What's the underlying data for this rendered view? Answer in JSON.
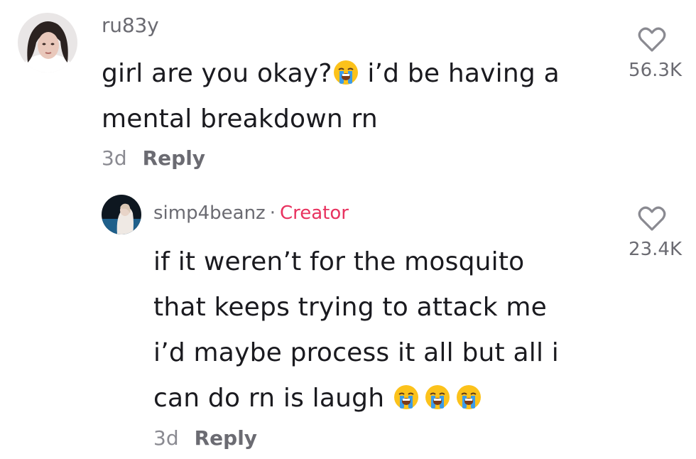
{
  "comment": {
    "username": "ru83y",
    "text_line1_a": "girl are you okay?",
    "text_line1_b": " i’d be having a",
    "text_line2": "mental breakdown rn",
    "emoji": "loudly-crying-face",
    "time": "3d",
    "reply_label": "Reply",
    "like_count": "56.3K"
  },
  "reply": {
    "username": "simp4beanz",
    "separator": "·",
    "badge": "Creator",
    "lines": [
      "if it weren’t for the mosquito",
      "that keeps trying to attack me",
      "i’d maybe process it all but all i",
      "can do rn is laugh "
    ],
    "emoji": "loudly-crying-face",
    "emoji_count": 3,
    "time": "3d",
    "reply_label": "Reply",
    "like_count": "23.4K"
  },
  "icons": {
    "like": "heart-outline-icon",
    "badge_color": "#e8325f"
  }
}
